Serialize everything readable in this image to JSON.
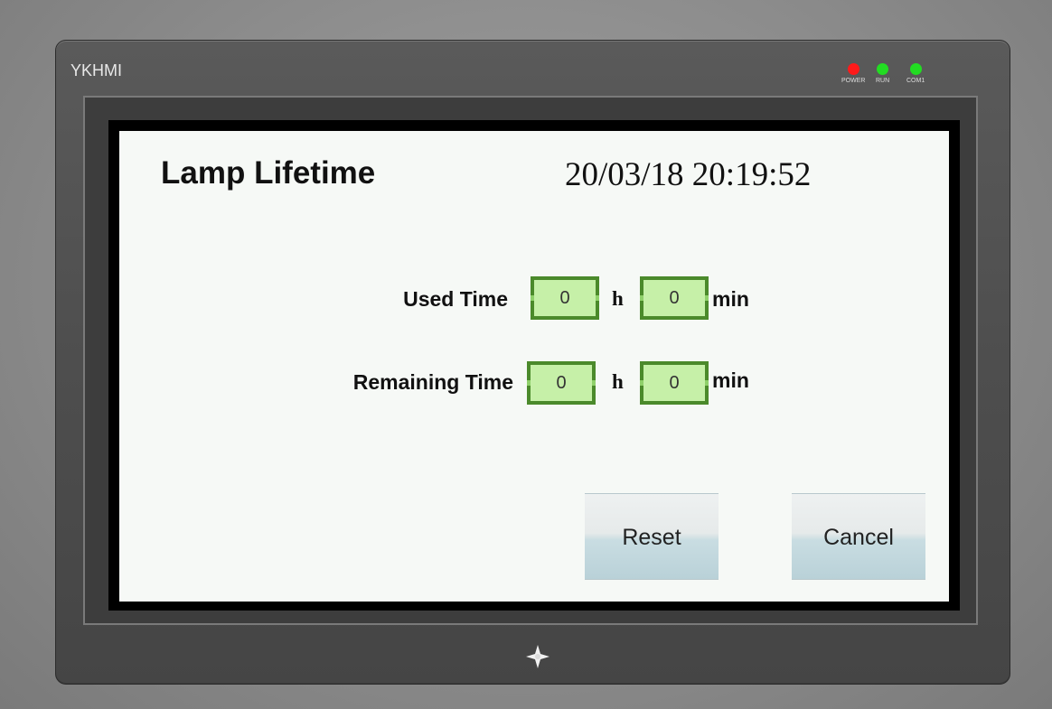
{
  "device": {
    "brand": "YKHMI",
    "leds": [
      {
        "label": "POWER",
        "color": "#ff1a1a"
      },
      {
        "label": "RUN",
        "color": "#22dd22"
      },
      {
        "label": "COM1",
        "color": "#22dd22"
      }
    ],
    "nav_icon": "four-point-star-icon"
  },
  "screen": {
    "title": "Lamp Lifetime",
    "datetime": "20/03/18 20:19:52",
    "used_time": {
      "label": "Used Time",
      "hours": "0",
      "hours_unit": "h",
      "minutes": "0",
      "minutes_unit": "min"
    },
    "remaining_time": {
      "label": "Remaining Time",
      "hours": "0",
      "hours_unit": "h",
      "minutes": "0",
      "minutes_unit": "min"
    },
    "buttons": {
      "reset": "Reset",
      "cancel": "Cancel"
    }
  },
  "colors": {
    "field_fill": "#c6f0a8",
    "field_border": "#4b8a2b",
    "screen_bg": "#f6f9f6"
  }
}
